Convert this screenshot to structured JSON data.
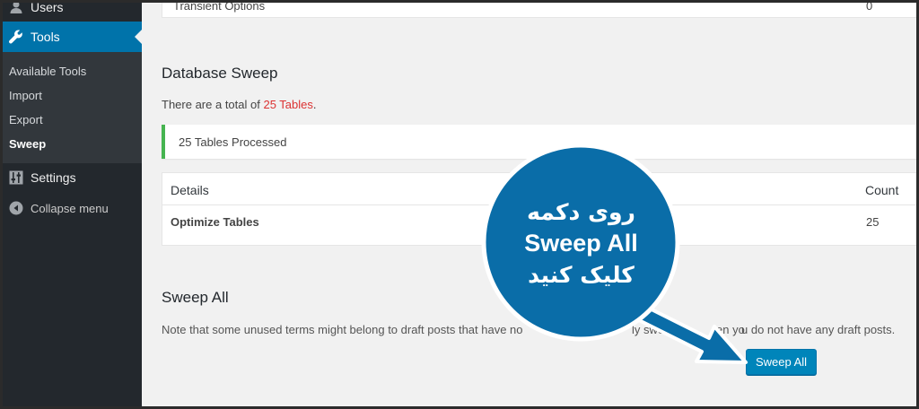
{
  "sidebar": {
    "users_label": "Users",
    "tools_label": "Tools",
    "submenu": [
      "Available Tools",
      "Import",
      "Export",
      "Sweep"
    ],
    "settings_label": "Settings",
    "collapse_label": "Collapse menu"
  },
  "top_row": {
    "label": "Transient Options",
    "value": "0"
  },
  "database_sweep": {
    "title": "Database Sweep",
    "total_prefix": "There are a total of",
    "total_value": "25 Tables",
    "total_suffix": ".",
    "notice": "25 Tables Processed",
    "table": {
      "headers": [
        "Details",
        "Count"
      ],
      "rows": [
        {
          "details": "Optimize Tables",
          "count": "25"
        }
      ]
    }
  },
  "sweep_all": {
    "title": "Sweep All",
    "note": "Note that some unused terms might belong to draft posts that have no",
    "note_end": "u do not have any draft posts.",
    "note_frag1": "ly swe",
    "note_frag2": "en yo",
    "button": "Sweep All"
  },
  "annotation": {
    "line1": "روی دکمه",
    "line2": "Sweep All",
    "line3": "کلیک کنید"
  },
  "colors": {
    "accent": "#0073aa",
    "button": "#0085ba",
    "bubble": "#0a6da8",
    "notice_border": "#46b450",
    "highlight_red": "#dc3232"
  }
}
